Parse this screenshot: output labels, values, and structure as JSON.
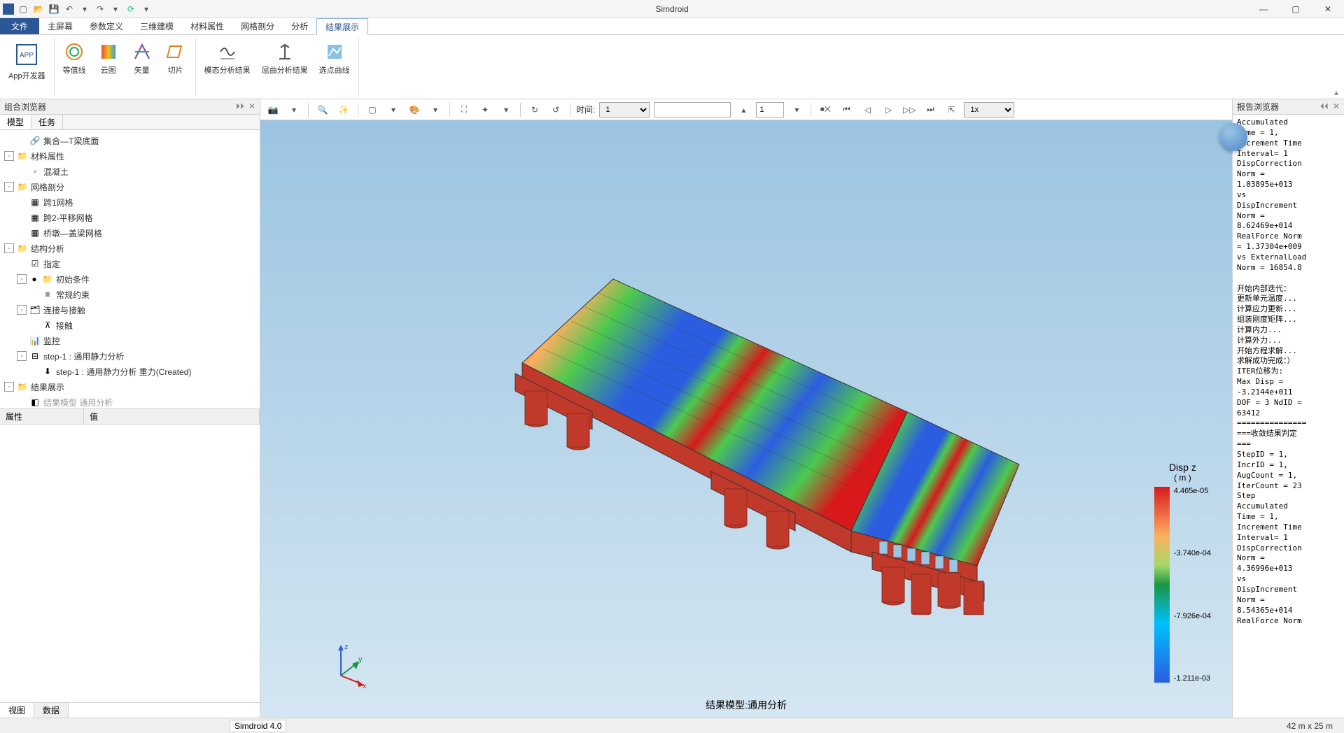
{
  "app": {
    "title": "Simdroid"
  },
  "menu": {
    "file": "文件",
    "items": [
      "主屏幕",
      "参数定义",
      "三维建模",
      "材料属性",
      "网格剖分",
      "分析",
      "结果展示"
    ],
    "active_index": 6
  },
  "ribbon": {
    "app_dev": "App开发器",
    "contour": "等值线",
    "cloud": "云图",
    "vector": "矢量",
    "slice": "切片",
    "modal": "模态分析结果",
    "buckling": "屈曲分析结果",
    "curve": "选点曲线"
  },
  "left": {
    "panel_title": "组合浏览器",
    "tabs": [
      "模型",
      "任务"
    ],
    "nodes": [
      {
        "depth": 2,
        "icon": "link",
        "label": "集合—T梁底面"
      },
      {
        "depth": 0,
        "toggle": "-",
        "icon": "folder",
        "label": "材料属性"
      },
      {
        "depth": 2,
        "icon": "bullet",
        "label": "混凝土"
      },
      {
        "depth": 0,
        "toggle": "-",
        "icon": "folder",
        "label": "网格剖分"
      },
      {
        "depth": 2,
        "icon": "mesh",
        "label": "跨1网格"
      },
      {
        "depth": 2,
        "icon": "mesh",
        "label": "跨2-平移网格"
      },
      {
        "depth": 2,
        "icon": "mesh",
        "label": "桥墩—盖梁网格"
      },
      {
        "depth": 0,
        "toggle": "-",
        "icon": "folder",
        "label": "结构分析"
      },
      {
        "depth": 2,
        "icon": "assign",
        "label": "指定"
      },
      {
        "depth": 1,
        "toggle": "-",
        "dot": true,
        "icon": "folder",
        "label": "初始条件"
      },
      {
        "depth": 3,
        "icon": "bc",
        "label": "常规约束"
      },
      {
        "depth": 1,
        "toggle": "-",
        "icon": "folder2",
        "label": "连接与接触"
      },
      {
        "depth": 3,
        "icon": "contact",
        "label": "接触"
      },
      {
        "depth": 2,
        "icon": "monitor",
        "label": "监控"
      },
      {
        "depth": 1,
        "toggle": "-",
        "icon": "step",
        "label": "step-1 : 通用静力分析"
      },
      {
        "depth": 3,
        "icon": "load",
        "label": "step-1 : 通用静力分析 重力(Created)"
      },
      {
        "depth": 0,
        "toggle": "-",
        "icon": "folder",
        "label": "结果展示"
      },
      {
        "depth": 1,
        "toggle": "",
        "icon": "result",
        "label": "结果模型 通用分析",
        "faded": true
      }
    ],
    "props_cols": [
      "属性",
      "值"
    ],
    "bottom_tabs": [
      "视图",
      "数据"
    ]
  },
  "viewport": {
    "toolbar": {
      "time_label": "时间:",
      "time_value": "1",
      "frame_value": "1",
      "speed": "1x"
    },
    "caption": "结果模型:通用分析",
    "legend": {
      "title": "Disp z",
      "unit": "( m )",
      "values": [
        "4.465e-05",
        "-3.740e-04",
        "-7.926e-04",
        "-1.211e-03"
      ]
    }
  },
  "right": {
    "panel_title": "报告浏览器",
    "log": "Accumulated\nTime = 1,\nIncrement Time\nInterval= 1\nDispCorrection\nNorm =\n1.03895e+013\nvs\nDispIncrement\nNorm =\n8.62469e+014\nRealForce Norm\n= 1.37304e+009\nvs ExternalLoad\nNorm = 16854.8\n\n开始内部迭代：\n更新单元温度...\n计算应力更新...\n组装刚度矩阵...\n计算内力...\n计算外力...\n开始方程求解...\n求解成功完成：）\nITER位移为:\nMax Disp =\n-3.2144e+011\nDOF = 3 NdID =\n63412\n===============\n===收敛结果判定\n===\nStepID = 1,\nIncrID = 1,\nAugCount = 1,\nIterCount = 23\nStep\nAccumulated\nTime = 1,\nIncrement Time\nInterval= 1\nDispCorrection\nNorm =\n4.36996e+013\nvs\nDispIncrement\nNorm =\n8.54365e+014\nRealForce Norm"
  },
  "status": {
    "left": "Simdroid 4.0",
    "right": "42 m x 25 m"
  }
}
